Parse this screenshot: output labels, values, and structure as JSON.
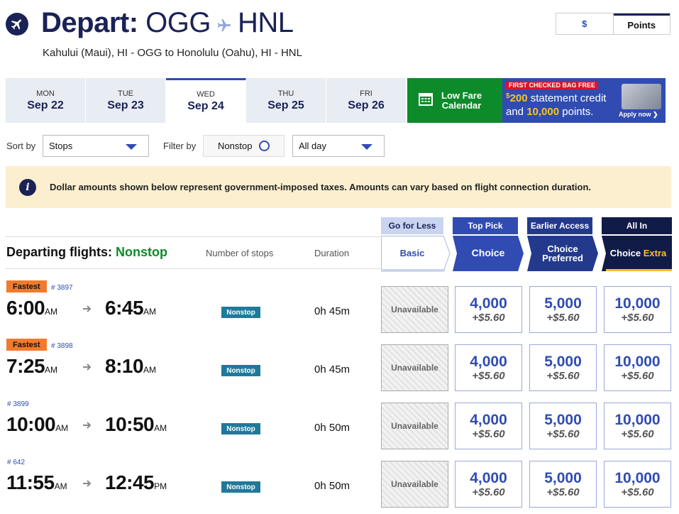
{
  "header": {
    "depart_label": "Depart:",
    "origin": "OGG",
    "destination": "HNL",
    "subtitle": "Kahului (Maui), HI - OGG to Honolulu (Oahu), HI - HNL"
  },
  "currency_toggle": {
    "dollar": "$",
    "points": "Points",
    "selected": "Points"
  },
  "dates": [
    {
      "dow": "MON",
      "date": "Sep 22"
    },
    {
      "dow": "TUE",
      "date": "Sep 23"
    },
    {
      "dow": "WED",
      "date": "Sep 24"
    },
    {
      "dow": "THU",
      "date": "Sep 25"
    },
    {
      "dow": "FRI",
      "date": "Sep 26"
    }
  ],
  "selected_date_index": 2,
  "low_fare": {
    "label_line1": "Low Fare",
    "label_line2": "Calendar"
  },
  "promo": {
    "badge": "FIRST CHECKED BAG FREE",
    "amount": "200",
    "line1_rest": " statement credit",
    "line2_prefix": "and ",
    "points": "10,000",
    "line2_suffix": " points.",
    "apply": "Apply now"
  },
  "controls": {
    "sort_label": "Sort by",
    "sort_value": "Stops",
    "filter_label": "Filter by",
    "nonstop_filter": "Nonstop",
    "time_value": "All day"
  },
  "info_banner": "Dollar amounts shown below represent government-imposed taxes. Amounts can vary based on flight connection duration.",
  "results_header": {
    "title_prefix": "Departing flights: ",
    "title_filter": "Nonstop",
    "col_stops": "Number of stops",
    "col_duration": "Duration"
  },
  "fare_columns": [
    {
      "top": "Go for Less",
      "bottom": "Basic"
    },
    {
      "top": "Top Pick",
      "bottom": "Choice"
    },
    {
      "top": "Earlier Access",
      "bottom": "Choice Preferred"
    },
    {
      "top": "All In",
      "bottom_main": "Choice",
      "bottom_accent": "Extra"
    }
  ],
  "flights": [
    {
      "badge": "Fastest",
      "flight_no": "# 3897",
      "depart_time": "6:00",
      "depart_ampm": "AM",
      "arrive_time": "6:45",
      "arrive_ampm": "AM",
      "stops": "Nonstop",
      "duration": "0h 45m",
      "basic": "Unavailable",
      "fares": [
        {
          "points": "4,000",
          "tax": "+$5.60"
        },
        {
          "points": "5,000",
          "tax": "+$5.60"
        },
        {
          "points": "10,000",
          "tax": "+$5.60"
        }
      ]
    },
    {
      "badge": "Fastest",
      "flight_no": "# 3898",
      "depart_time": "7:25",
      "depart_ampm": "AM",
      "arrive_time": "8:10",
      "arrive_ampm": "AM",
      "stops": "Nonstop",
      "duration": "0h 45m",
      "basic": "Unavailable",
      "fares": [
        {
          "points": "4,000",
          "tax": "+$5.60"
        },
        {
          "points": "5,000",
          "tax": "+$5.60"
        },
        {
          "points": "10,000",
          "tax": "+$5.60"
        }
      ]
    },
    {
      "badge": "",
      "flight_no": "# 3899",
      "depart_time": "10:00",
      "depart_ampm": "AM",
      "arrive_time": "10:50",
      "arrive_ampm": "AM",
      "stops": "Nonstop",
      "duration": "0h 50m",
      "basic": "Unavailable",
      "fares": [
        {
          "points": "4,000",
          "tax": "+$5.60"
        },
        {
          "points": "5,000",
          "tax": "+$5.60"
        },
        {
          "points": "10,000",
          "tax": "+$5.60"
        }
      ]
    },
    {
      "badge": "",
      "flight_no": "# 642",
      "depart_time": "11:55",
      "depart_ampm": "AM",
      "arrive_time": "12:45",
      "arrive_ampm": "PM",
      "stops": "Nonstop",
      "duration": "0h 50m",
      "basic": "Unavailable",
      "fares": [
        {
          "points": "4,000",
          "tax": "+$5.60"
        },
        {
          "points": "5,000",
          "tax": "+$5.60"
        },
        {
          "points": "10,000",
          "tax": "+$5.60"
        }
      ]
    }
  ],
  "colors": {
    "navy": "#1a2256",
    "blue": "#304cb2",
    "green": "#0d8a2a",
    "orange": "#f37a2d",
    "info_bg": "#fcefcf",
    "promo_red": "#d5152e",
    "gold": "#ffbf27"
  }
}
